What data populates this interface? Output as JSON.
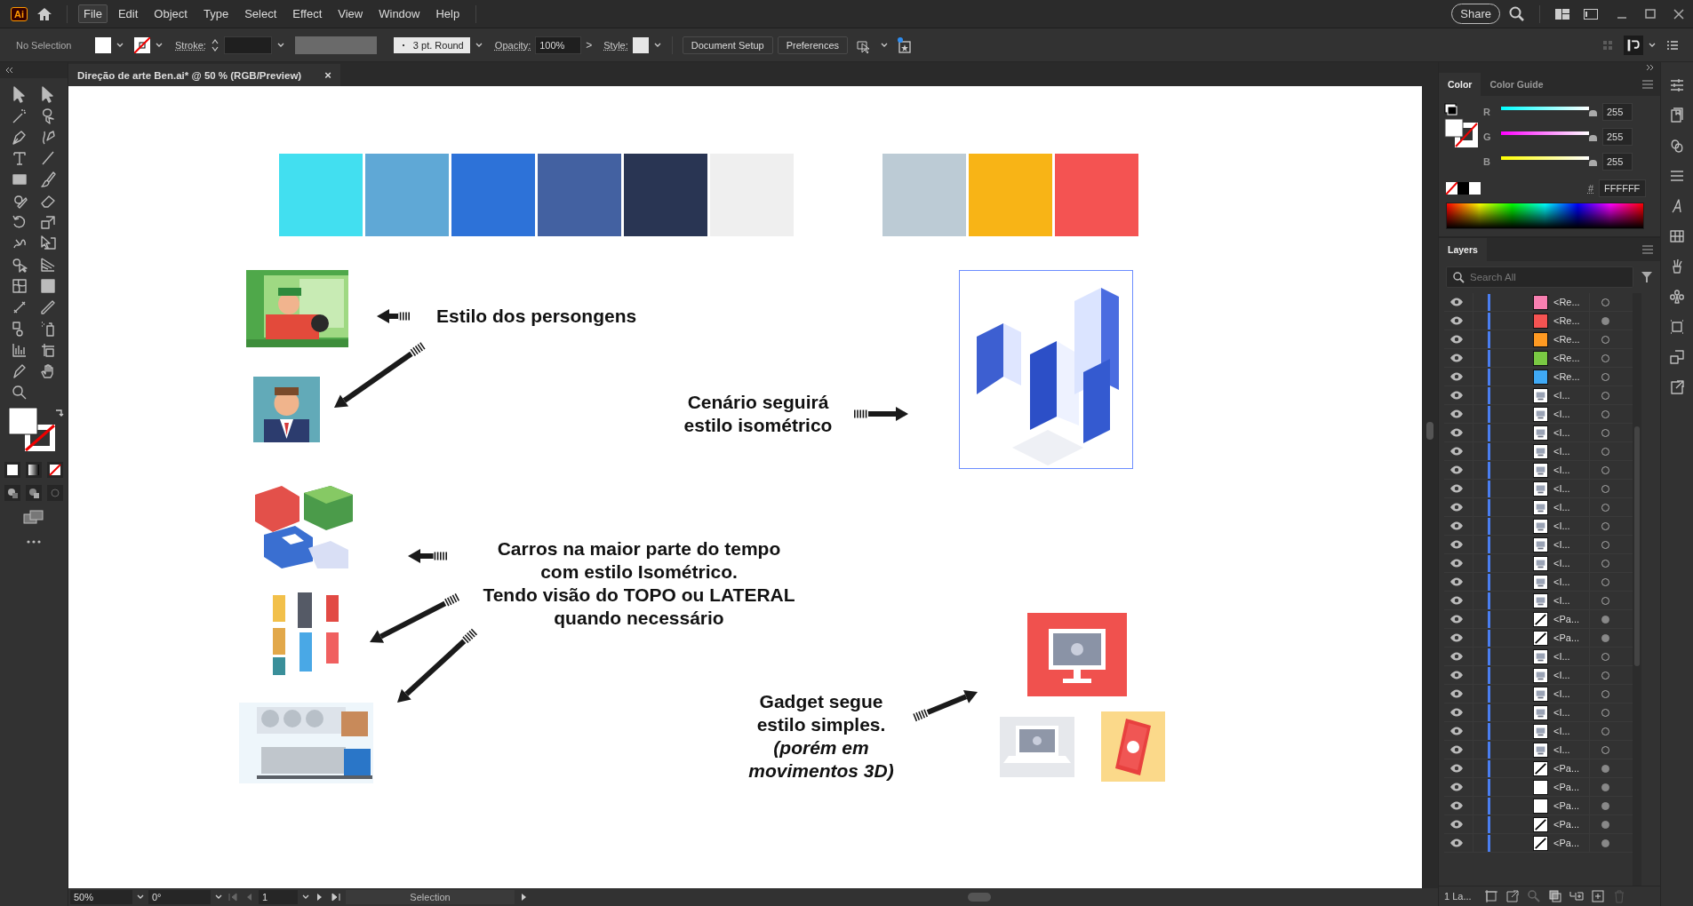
{
  "app": {
    "logo": "Ai"
  },
  "menu": [
    {
      "label": "File",
      "selected": true
    },
    {
      "label": "Edit",
      "selected": false
    },
    {
      "label": "Object",
      "selected": false
    },
    {
      "label": "Type",
      "selected": false
    },
    {
      "label": "Select",
      "selected": false
    },
    {
      "label": "Effect",
      "selected": false
    },
    {
      "label": "View",
      "selected": false
    },
    {
      "label": "Window",
      "selected": false
    },
    {
      "label": "Help",
      "selected": false
    }
  ],
  "share": "Share",
  "control_bar": {
    "selection": "No Selection",
    "stroke_label": "Stroke:",
    "brush": "3 pt. Round",
    "opacity_label": "Opacity:",
    "opacity": "100%",
    "opacity_more": ">",
    "style_label": "Style:",
    "buttons": [
      "Document Setup",
      "Preferences"
    ]
  },
  "document_tab": {
    "title": "Direção de arte Ben.ai* @ 50 % (RGB/Preview)",
    "close": "×"
  },
  "artboard": {
    "palette": [
      {
        "swatches": [
          {
            "color": "#42dff0"
          },
          {
            "color": "#5fa8d6"
          },
          {
            "color": "#2d72d8"
          },
          {
            "color": "#4361a1"
          },
          {
            "color": "#293553"
          },
          {
            "color": "#efefef"
          }
        ]
      },
      {
        "swatches": [
          {
            "color": "#bccbd5"
          },
          {
            "color": "#f8b416"
          },
          {
            "color": "#f45352"
          }
        ]
      }
    ],
    "notes": [
      {
        "lines": [
          "Estilo dos persongens"
        ]
      },
      {
        "lines": [
          "Cenário seguirá",
          "estilo isométrico"
        ]
      },
      {
        "lines": [
          "Carros na maior parte do tempo",
          "com estilo Isométrico.",
          "Tendo visão do TOPO ou LATERAL",
          "quando necessário"
        ]
      },
      {
        "lines": [
          "Gadget segue",
          "estilo simples.",
          "*(porém em*",
          "*movimentos  3D)*"
        ]
      }
    ]
  },
  "color_panel": {
    "tabs": [
      {
        "label": "Color",
        "selected": true
      },
      {
        "label": "Color Guide",
        "selected": false
      }
    ],
    "channels": [
      {
        "name": "R",
        "level": 1,
        "value": "255"
      },
      {
        "name": "G",
        "level": 1,
        "value": "255"
      },
      {
        "name": "B",
        "level": 1,
        "value": "255"
      }
    ],
    "hex_label": "#",
    "hex": "FFFFFF"
  },
  "layers_panel": {
    "tab": "Layers",
    "search": {
      "placeholder": "Search All"
    },
    "rows": [
      {
        "name": "<Re...",
        "kind": "color",
        "color": "#f77fb0",
        "appearance": false
      },
      {
        "name": "<Re...",
        "kind": "color",
        "color": "#f45352",
        "appearance": true
      },
      {
        "name": "<Re...",
        "kind": "color",
        "color": "#ff9a22",
        "appearance": false
      },
      {
        "name": "<Re...",
        "kind": "color",
        "color": "#7ac943",
        "appearance": false
      },
      {
        "name": "<Re...",
        "kind": "color",
        "color": "#3fa9f5",
        "appearance": false
      },
      {
        "name": "<I...",
        "appearance": false
      },
      {
        "name": "<I...",
        "appearance": false
      },
      {
        "name": "<I...",
        "appearance": false
      },
      {
        "name": "<I...",
        "appearance": false
      },
      {
        "name": "<I...",
        "appearance": false
      },
      {
        "name": "<I...",
        "appearance": false
      },
      {
        "name": "<I...",
        "appearance": false
      },
      {
        "name": "<I...",
        "appearance": false
      },
      {
        "name": "<I...",
        "appearance": false
      },
      {
        "name": "<I...",
        "appearance": false
      },
      {
        "name": "<I...",
        "appearance": false
      },
      {
        "name": "<I...",
        "appearance": false
      },
      {
        "name": "<Pa...",
        "kind": "path",
        "appearance": true
      },
      {
        "name": "<Pa...",
        "kind": "path",
        "appearance": true
      },
      {
        "name": "<I...",
        "appearance": false
      },
      {
        "name": "<I...",
        "appearance": false
      },
      {
        "name": "<I...",
        "appearance": false
      },
      {
        "name": "<I...",
        "appearance": false
      },
      {
        "name": "<I...",
        "appearance": false
      },
      {
        "name": "<I...",
        "appearance": false
      },
      {
        "name": "<Pa...",
        "kind": "path",
        "appearance": true
      },
      {
        "name": "<Pa...",
        "kind": "blank",
        "appearance": true
      },
      {
        "name": "<Pa...",
        "kind": "blank",
        "appearance": true
      },
      {
        "name": "<Pa...",
        "kind": "path",
        "appearance": true
      },
      {
        "name": "<Pa...",
        "kind": "path",
        "appearance": true
      }
    ],
    "footer": "1 La..."
  },
  "status_bar": {
    "zoom": "50%",
    "rotation": "0°",
    "artboard": "1",
    "tool": "Selection"
  }
}
